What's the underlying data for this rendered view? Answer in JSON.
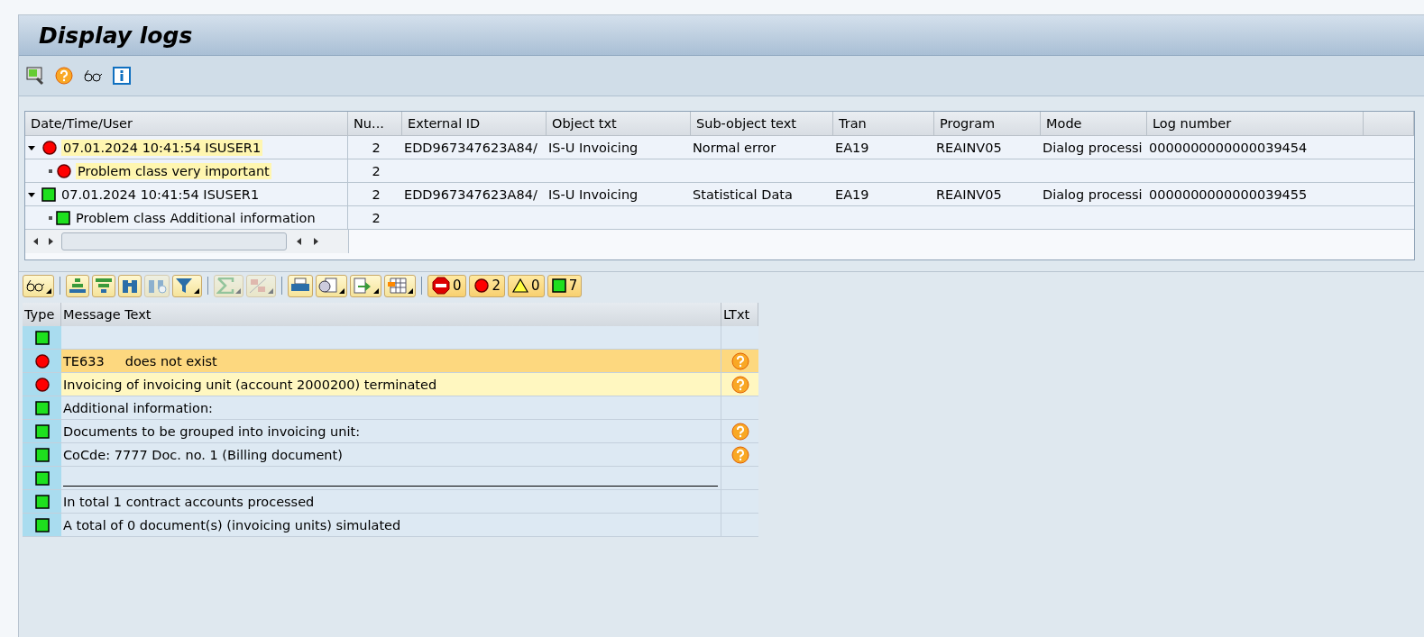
{
  "window": {
    "title": "Display logs"
  },
  "app_toolbar": [
    {
      "kind": "monitor"
    },
    {
      "kind": "help"
    },
    {
      "kind": "glasses"
    },
    {
      "kind": "info"
    }
  ],
  "log_table": {
    "columns": [
      "Date/Time/User",
      "Nu...",
      "External ID",
      "Object txt",
      "Sub-object text",
      "Tran",
      "Program",
      "Mode",
      "Log number"
    ],
    "rows": [
      {
        "error": true,
        "expanded": true,
        "cells": [
          "07.01.2024  10:41:54  ISUSER1",
          "2",
          "EDD967347623A84/",
          "IS-U Invoicing",
          "Normal error",
          "EA19",
          "REAINV05",
          "Dialog processi",
          "0000000000000039454"
        ],
        "children": [
          {
            "error": true,
            "cells": [
              "Problem class very important",
              "2"
            ]
          }
        ]
      },
      {
        "error": false,
        "expanded": true,
        "cells": [
          "07.01.2024  10:41:54  ISUSER1",
          "2",
          "EDD967347623A84/",
          "IS-U Invoicing",
          "Statistical Data",
          "EA19",
          "REAINV05",
          "Dialog processi",
          "0000000000000039455"
        ],
        "children": [
          {
            "error": false,
            "cells": [
              "Problem class Additional information",
              "2"
            ]
          }
        ]
      }
    ]
  },
  "message_toolbar": [
    {
      "buttons": [
        {
          "kind": "glasses",
          "menu": true,
          "disabled": false
        }
      ]
    },
    {
      "buttons": [
        {
          "kind": "sort-up",
          "menu": false,
          "disabled": false
        },
        {
          "kind": "sort-down",
          "menu": false,
          "disabled": false
        },
        {
          "kind": "find",
          "menu": false,
          "disabled": false
        },
        {
          "kind": "find-next",
          "menu": false,
          "disabled": true
        },
        {
          "kind": "filter",
          "menu": true,
          "disabled": false
        }
      ]
    },
    {
      "buttons": [
        {
          "kind": "sum",
          "menu": true,
          "disabled": true
        },
        {
          "kind": "subtotal",
          "menu": true,
          "disabled": true
        }
      ]
    },
    {
      "buttons": [
        {
          "kind": "print",
          "menu": false,
          "disabled": false
        },
        {
          "kind": "views",
          "menu": true,
          "disabled": false
        },
        {
          "kind": "export",
          "menu": true,
          "disabled": false
        },
        {
          "kind": "layout",
          "menu": true,
          "disabled": false
        }
      ]
    }
  ],
  "counters": [
    {
      "kind": "stop",
      "count": "0"
    },
    {
      "kind": "error",
      "count": "2"
    },
    {
      "kind": "warning",
      "count": "0"
    },
    {
      "kind": "success",
      "count": "7"
    }
  ],
  "messages": {
    "columns": [
      "Type",
      "Message Text",
      "LTxt"
    ],
    "rows": [
      {
        "kind": "empty",
        "error": false,
        "selected": false,
        "long_text": false
      },
      {
        "kind": "text",
        "error": true,
        "selected": true,
        "text": "TE633     does not exist",
        "long_text": true
      },
      {
        "kind": "text",
        "error": true,
        "selected": false,
        "text": "Invoicing of invoicing unit (account 2000200) terminated",
        "long_text": true
      },
      {
        "kind": "text",
        "error": false,
        "selected": false,
        "text": "Additional information:",
        "long_text": false
      },
      {
        "kind": "text",
        "error": false,
        "selected": false,
        "text": "Documents to be grouped into invoicing unit:",
        "long_text": true
      },
      {
        "kind": "text",
        "error": false,
        "selected": false,
        "text": "CoCde: 7777 Doc. no. 1 (Billing document)",
        "long_text": true
      },
      {
        "kind": "rule",
        "error": false,
        "selected": false,
        "long_text": false
      },
      {
        "kind": "text",
        "error": false,
        "selected": false,
        "text": "In total 1 contract accounts processed",
        "long_text": false
      },
      {
        "kind": "text",
        "error": false,
        "selected": false,
        "text": "A total of 0 document(s) (invoicing units) simulated",
        "long_text": false
      }
    ]
  }
}
